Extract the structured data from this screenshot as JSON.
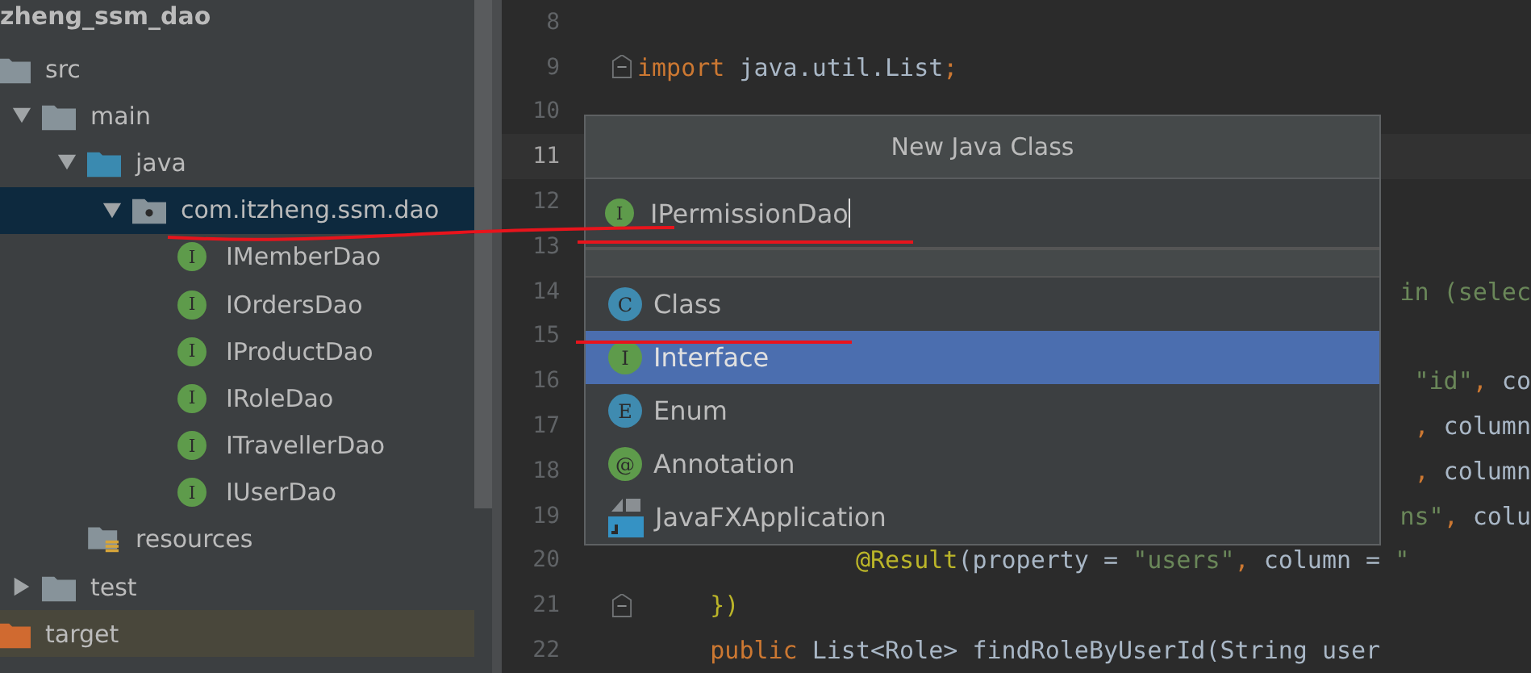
{
  "project": {
    "title": "zheng_ssm_dao",
    "tree": [
      {
        "name": "src",
        "kind": "folder",
        "expanded": true,
        "selected": false,
        "children": [
          {
            "name": "main",
            "kind": "folder",
            "expanded": true,
            "selected": false,
            "children": [
              {
                "name": "java",
                "kind": "source-folder",
                "expanded": true,
                "selected": false,
                "children": [
                  {
                    "name": "com.itzheng.ssm.dao",
                    "kind": "package",
                    "expanded": true,
                    "selected": true,
                    "children": [
                      {
                        "name": "IMemberDao",
                        "kind": "interface",
                        "badge": "I",
                        "selected": false
                      },
                      {
                        "name": "IOrdersDao",
                        "kind": "interface",
                        "badge": "I",
                        "selected": false
                      },
                      {
                        "name": "IProductDao",
                        "kind": "interface",
                        "badge": "I",
                        "selected": false
                      },
                      {
                        "name": "IRoleDao",
                        "kind": "interface",
                        "badge": "I",
                        "selected": false
                      },
                      {
                        "name": "ITravellerDao",
                        "kind": "interface",
                        "badge": "I",
                        "selected": false
                      },
                      {
                        "name": "IUserDao",
                        "kind": "interface",
                        "badge": "I",
                        "selected": false
                      }
                    ]
                  }
                ]
              },
              {
                "name": "resources",
                "kind": "resources-folder",
                "selected": false
              }
            ]
          },
          {
            "name": "test",
            "kind": "folder",
            "expanded": false,
            "selected": false
          }
        ]
      },
      {
        "name": "target",
        "kind": "target-folder",
        "selected": false
      }
    ]
  },
  "editor": {
    "lines": [
      {
        "number": "8",
        "current": false
      },
      {
        "number": "9",
        "current": false,
        "fold": true,
        "kind": "full",
        "segments": [
          {
            "text": "import",
            "kind": "keyword"
          },
          {
            "text": " java.util.List",
            "kind": "plain"
          },
          {
            "text": ";",
            "kind": "keyword"
          }
        ]
      },
      {
        "number": "10",
        "current": false
      },
      {
        "number": "11",
        "current": true
      },
      {
        "number": "12",
        "current": false
      },
      {
        "number": "13",
        "current": false
      },
      {
        "number": "14",
        "current": false,
        "kind": "tail",
        "segments": [
          {
            "text": "in (selec",
            "kind": "string"
          }
        ]
      },
      {
        "number": "15",
        "current": false
      },
      {
        "number": "16",
        "current": false,
        "kind": "tail",
        "segments": [
          {
            "text": "\"id\"",
            "kind": "string"
          },
          {
            "text": ",",
            "kind": "keyword"
          },
          {
            "text": " co",
            "kind": "plain"
          }
        ]
      },
      {
        "number": "17",
        "current": false,
        "kind": "tail",
        "segments": [
          {
            "text": ",",
            "kind": "keyword"
          },
          {
            "text": " column",
            "kind": "plain"
          }
        ]
      },
      {
        "number": "18",
        "current": false,
        "kind": "tail",
        "segments": [
          {
            "text": ",",
            "kind": "keyword"
          },
          {
            "text": " column",
            "kind": "plain"
          }
        ]
      },
      {
        "number": "19",
        "current": false,
        "kind": "tail",
        "segments": [
          {
            "text": "ns\"",
            "kind": "string"
          },
          {
            "text": ",",
            "kind": "keyword"
          },
          {
            "text": " colu",
            "kind": "plain"
          }
        ]
      },
      {
        "number": "20",
        "current": false,
        "kind": "full",
        "segments": [
          {
            "text": "               @Result",
            "kind": "annotation"
          },
          {
            "text": "(property = ",
            "kind": "plain"
          },
          {
            "text": "\"users\"",
            "kind": "string"
          },
          {
            "text": ",",
            "kind": "keyword"
          },
          {
            "text": " column = ",
            "kind": "plain"
          },
          {
            "text": "\"",
            "kind": "string"
          }
        ]
      },
      {
        "number": "21",
        "current": false,
        "fold": true,
        "kind": "full",
        "segments": [
          {
            "text": "     })",
            "kind": "annotation"
          }
        ]
      },
      {
        "number": "22",
        "current": false,
        "kind": "full",
        "segments": [
          {
            "text": "     public",
            "kind": "keyword"
          },
          {
            "text": " List<Role> findRoleByUserId(String user",
            "kind": "plain"
          }
        ]
      }
    ]
  },
  "dialog": {
    "title": "New Java Class",
    "field": {
      "value": "IPermissionDao",
      "badge": "I"
    },
    "kinds": [
      {
        "label": "Class",
        "kind": "class",
        "badge": "C",
        "selected": false
      },
      {
        "label": "Interface",
        "kind": "interface",
        "badge": "I",
        "selected": true
      },
      {
        "label": "Enum",
        "kind": "enum",
        "badge": "E",
        "selected": false
      },
      {
        "label": "Annotation",
        "kind": "annotation",
        "badge": "@",
        "selected": false
      },
      {
        "label": "JavaFXApplication",
        "kind": "javafx",
        "selected": false
      }
    ]
  }
}
